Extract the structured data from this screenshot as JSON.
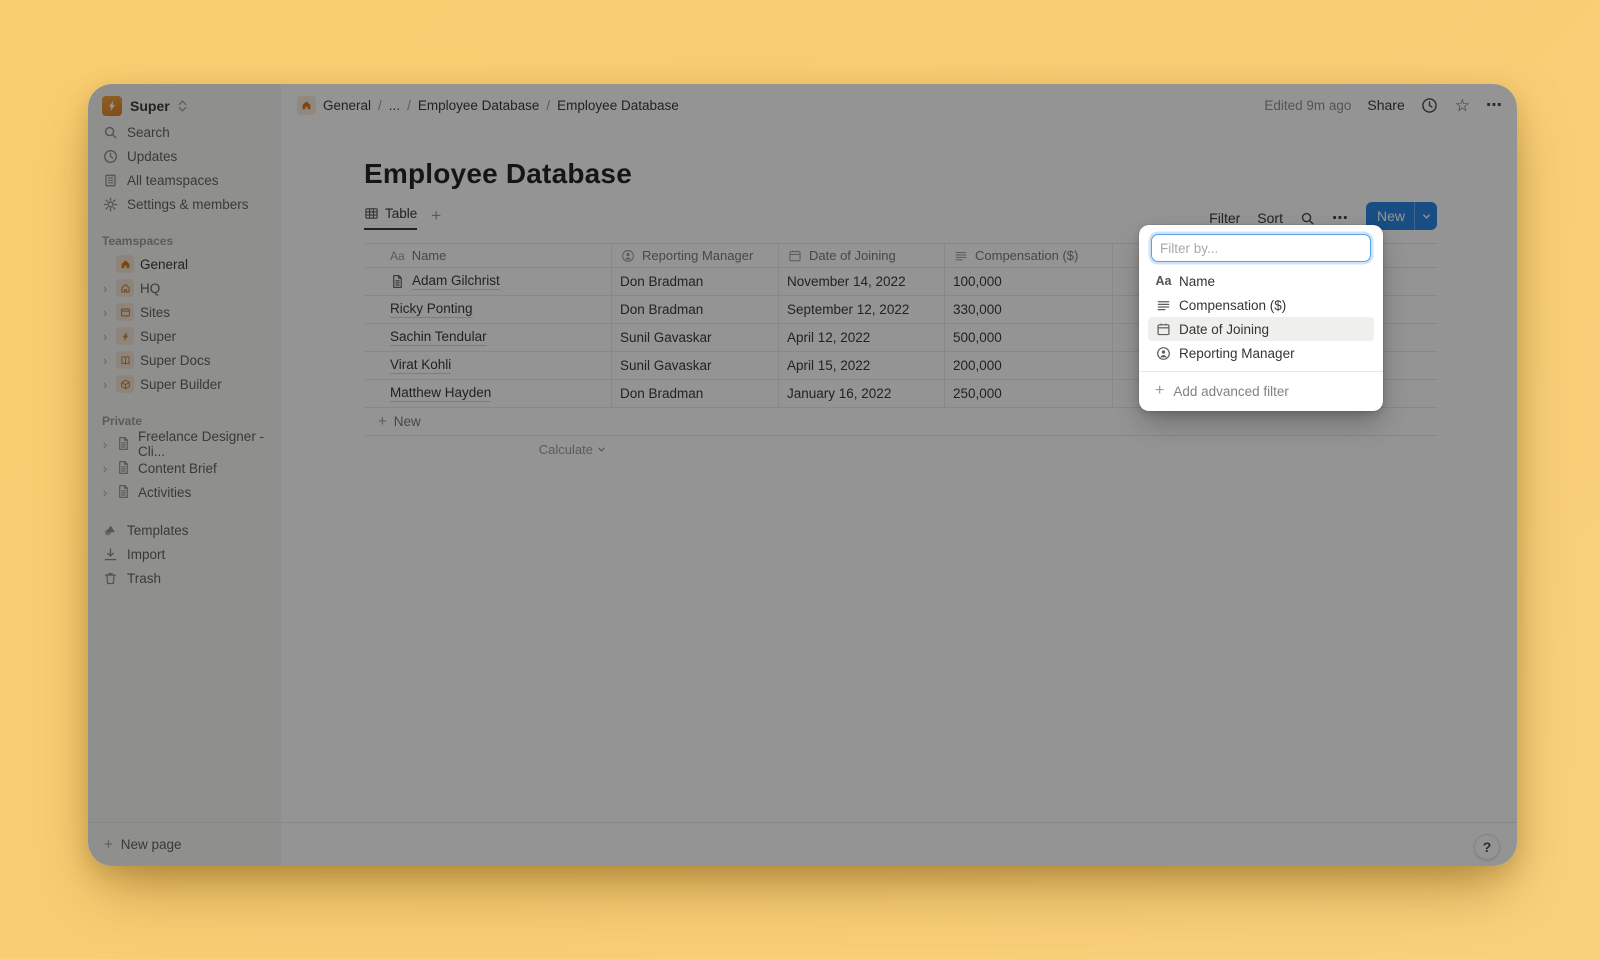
{
  "workspace": {
    "name": "Super"
  },
  "sidebar": {
    "nav": [
      {
        "label": "Search"
      },
      {
        "label": "Updates"
      },
      {
        "label": "All teamspaces"
      },
      {
        "label": "Settings & members"
      }
    ],
    "teamspaces_label": "Teamspaces",
    "teamspaces": [
      {
        "label": "General"
      },
      {
        "label": "HQ"
      },
      {
        "label": "Sites"
      },
      {
        "label": "Super"
      },
      {
        "label": "Super Docs"
      },
      {
        "label": "Super Builder"
      }
    ],
    "private_label": "Private",
    "private": [
      {
        "label": "Freelance Designer - Cli..."
      },
      {
        "label": "Content Brief"
      },
      {
        "label": "Activities"
      }
    ],
    "tools": [
      {
        "label": "Templates"
      },
      {
        "label": "Import"
      },
      {
        "label": "Trash"
      }
    ],
    "new_page": "New page"
  },
  "breadcrumb": {
    "root": "General",
    "sep": "/",
    "ellipsis": "...",
    "level1": "Employee Database",
    "level2": "Employee Database"
  },
  "topbar": {
    "edited": "Edited 9m ago",
    "share": "Share"
  },
  "page": {
    "title": "Employee Database"
  },
  "views": {
    "table_tab": "Table"
  },
  "toolbar": {
    "filter": "Filter",
    "sort": "Sort",
    "new": "New"
  },
  "table": {
    "columns": [
      {
        "label": "Name"
      },
      {
        "label": "Reporting Manager"
      },
      {
        "label": "Date of Joining"
      },
      {
        "label": "Compensation ($)"
      }
    ],
    "rows": [
      {
        "name": "Adam Gilchrist",
        "manager": "Don Bradman",
        "date": "November 14, 2022",
        "comp": "100,000"
      },
      {
        "name": "Ricky Ponting",
        "manager": "Don Bradman",
        "date": "September 12, 2022",
        "comp": "330,000"
      },
      {
        "name": "Sachin Tendular",
        "manager": "Sunil Gavaskar",
        "date": "April 12, 2022",
        "comp": "500,000"
      },
      {
        "name": "Virat Kohli",
        "manager": "Sunil Gavaskar",
        "date": "April 15, 2022",
        "comp": "200,000"
      },
      {
        "name": "Matthew Hayden",
        "manager": "Don Bradman",
        "date": "January 16, 2022",
        "comp": "250,000"
      }
    ],
    "new_row": "New",
    "calculate": "Calculate"
  },
  "filter_popup": {
    "placeholder": "Filter by...",
    "items": [
      {
        "label": "Name",
        "icon": "text-icon"
      },
      {
        "label": "Compensation ($)",
        "icon": "number-lines-icon"
      },
      {
        "label": "Date of Joining",
        "icon": "calendar-icon",
        "highlighted": true
      },
      {
        "label": "Reporting Manager",
        "icon": "person-icon"
      }
    ],
    "add_advanced": "Add advanced filter"
  },
  "help_label": "?",
  "colors": {
    "accent_blue": "#2383E2",
    "backdrop_yellow": "#F8CD74",
    "sidebar_bg": "#F7F7F5",
    "orange_icon": "#D9730D",
    "dim_overlay": "rgba(12,12,12,0.44)"
  }
}
